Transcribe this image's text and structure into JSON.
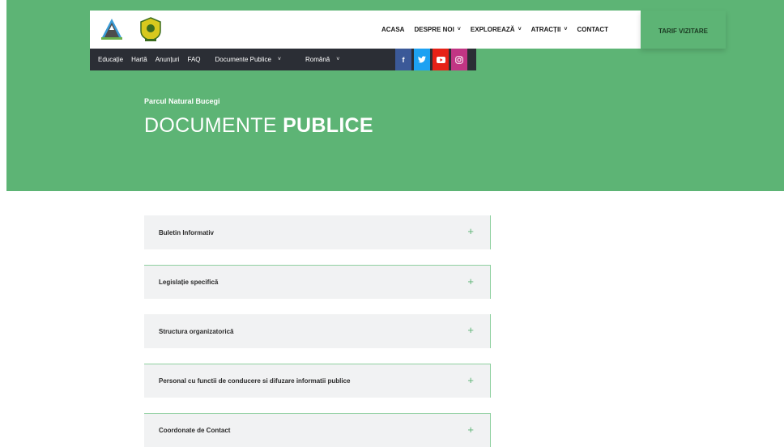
{
  "header": {
    "nav": [
      {
        "label": "ACASA",
        "has_dropdown": false
      },
      {
        "label": "DESPRE NOI",
        "has_dropdown": true
      },
      {
        "label": "EXPLOREAZĂ",
        "has_dropdown": true
      },
      {
        "label": "ATRACȚII",
        "has_dropdown": true
      },
      {
        "label": "CONTACT",
        "has_dropdown": false
      }
    ],
    "cta_label": "TARIF VIZITARE",
    "dropdown_chevron": "˅"
  },
  "subbar": {
    "links": [
      "Educație",
      "Hartă",
      "Anunțuri",
      "FAQ"
    ],
    "page_dropdown": "Documente Publice",
    "language_dropdown": "Română",
    "social": [
      {
        "icon": "facebook-icon",
        "glyph": "f",
        "color": "#3b5998"
      },
      {
        "icon": "twitter-icon",
        "glyph": "🐦",
        "color": "#1da1f2"
      },
      {
        "icon": "youtube-icon",
        "glyph": "▶",
        "color": "#e62117"
      },
      {
        "icon": "instagram-icon",
        "glyph": "◎",
        "color": "#c13584"
      }
    ]
  },
  "hero": {
    "eyebrow": "Parcul Natural Bucegi",
    "title_light": "DOCUMENTE",
    "title_bold": "PUBLICE",
    "background": "#5db475"
  },
  "accordion": {
    "expand_glyph": "+",
    "items": [
      "Buletin Informativ",
      "Legislație specifică",
      "Structura organizatorică",
      "Personal cu functii de conducere si difuzare informatii publice",
      "Coordonate de Contact"
    ]
  }
}
